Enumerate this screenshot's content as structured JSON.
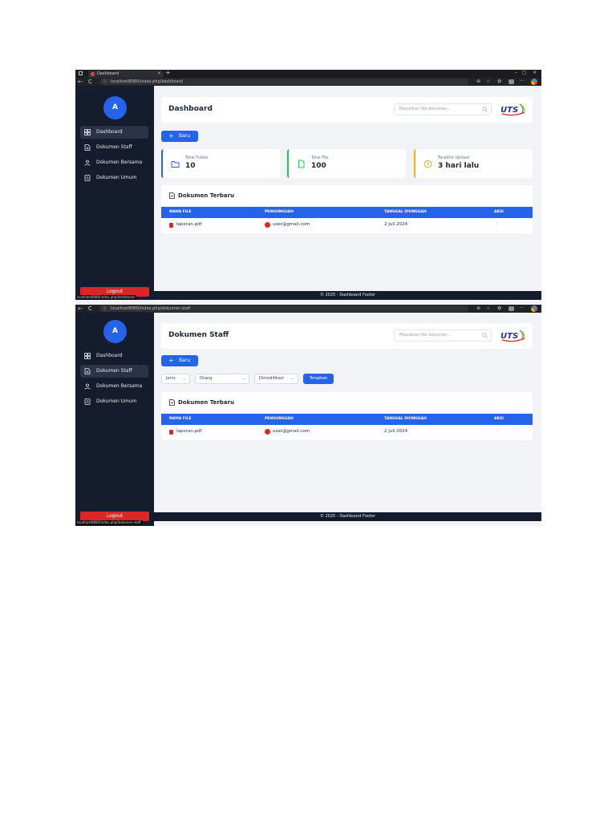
{
  "browser": {
    "tab_title": "Dashboard",
    "close_glyph": "×",
    "new_tab_glyph": "+",
    "window_minimize": "–",
    "window_maximize": "▢",
    "window_close": "×",
    "back_glyph": "←",
    "reload_glyph": "C",
    "info_glyph": "ⓘ",
    "menu_glyph": "···",
    "url_dashboard": "localhost8080/index.php/dashboard",
    "url_staff": "localhost8080/index.php/dokumen-staff",
    "status_dashboard": "localhost8080/index.php/dashboard",
    "status_staff": "localhost8080/index.php/dokumen-staff"
  },
  "sidebar": {
    "avatar_letter": "A",
    "items": [
      {
        "label": "Dashboard",
        "icon": "dashboard-grid-icon"
      },
      {
        "label": "Dokumen Staff",
        "icon": "document-icon"
      },
      {
        "label": "Dokumen Bersama",
        "icon": "users-icon"
      },
      {
        "label": "Dokumen Umum",
        "icon": "folder-doc-icon"
      }
    ],
    "logout_label": "Logout"
  },
  "search": {
    "placeholder": "Masukkan file dokumen..."
  },
  "dashboard": {
    "title": "Dashboard",
    "new_button_plus": "+",
    "new_button": "Baru",
    "stats": [
      {
        "label": "Total Folder",
        "value": "10",
        "color": "#2563eb"
      },
      {
        "label": "Total File",
        "value": "100",
        "color": "#22c55e"
      },
      {
        "label": "Terakhir Upload",
        "value": "3 hari lalu",
        "color": "#eab308"
      }
    ]
  },
  "staff": {
    "title": "Dokumen Staff",
    "new_button_plus": "+",
    "new_button": "Baru",
    "filters": [
      {
        "label": "Jenis",
        "chev": "⌄"
      },
      {
        "label": "Orang",
        "chev": "⌄"
      },
      {
        "label": "Dimodifikasi",
        "chev": "⌄"
      }
    ],
    "apply_button": "Terapkan"
  },
  "table": {
    "title": "Dokumen Terbaru",
    "headers": [
      "NAMA FILE",
      "PENGUNGGAH",
      "TANGGAL DIUNGGAH",
      "AKSI"
    ],
    "rows": [
      {
        "file": "laporan.pdf",
        "uploader": "user@gmail.com",
        "date": "2 Juli 2024",
        "action": "⋮"
      }
    ]
  },
  "footer": {
    "text": "© 2025 - Dashboard Footer"
  },
  "colors": {
    "accent": "#2563eb",
    "sidebar": "#151c2e",
    "logout": "#dc2626"
  }
}
